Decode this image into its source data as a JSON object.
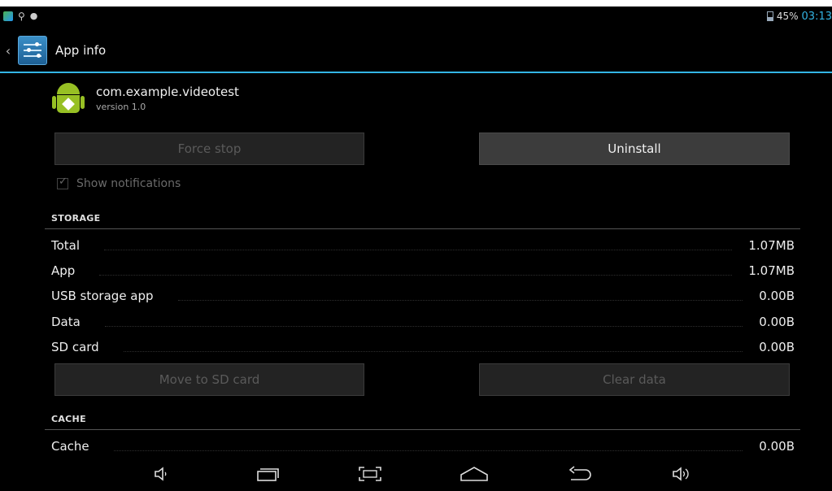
{
  "status_bar": {
    "battery_percent": "45%",
    "time": "03:13",
    "icons": [
      "gallery-icon",
      "usb-icon",
      "debug-icon",
      "battery-icon"
    ]
  },
  "action_bar": {
    "title": "App info",
    "icon": "settings-icon"
  },
  "app": {
    "package": "com.example.videotest",
    "version": "version 1.0",
    "icon": "android-icon"
  },
  "buttons": {
    "force_stop": "Force stop",
    "uninstall": "Uninstall",
    "move_to_sd": "Move to SD card",
    "clear_data": "Clear data"
  },
  "notifications": {
    "label": "Show notifications",
    "checked": true
  },
  "storage": {
    "header": "STORAGE",
    "rows": [
      {
        "label": "Total",
        "value": "1.07MB"
      },
      {
        "label": "App",
        "value": "1.07MB"
      },
      {
        "label": "USB storage app",
        "value": "0.00B"
      },
      {
        "label": "Data",
        "value": "0.00B"
      },
      {
        "label": "SD card",
        "value": "0.00B"
      }
    ]
  },
  "cache": {
    "header": "CACHE",
    "rows": [
      {
        "label": "Cache",
        "value": "0.00B"
      }
    ]
  },
  "navigation": {
    "icons": [
      "volume-down-icon",
      "recent-apps-icon",
      "screenshot-icon",
      "home-icon",
      "back-icon",
      "volume-up-icon"
    ]
  },
  "colors": {
    "accent": "#33b5e5",
    "background": "#000000"
  }
}
